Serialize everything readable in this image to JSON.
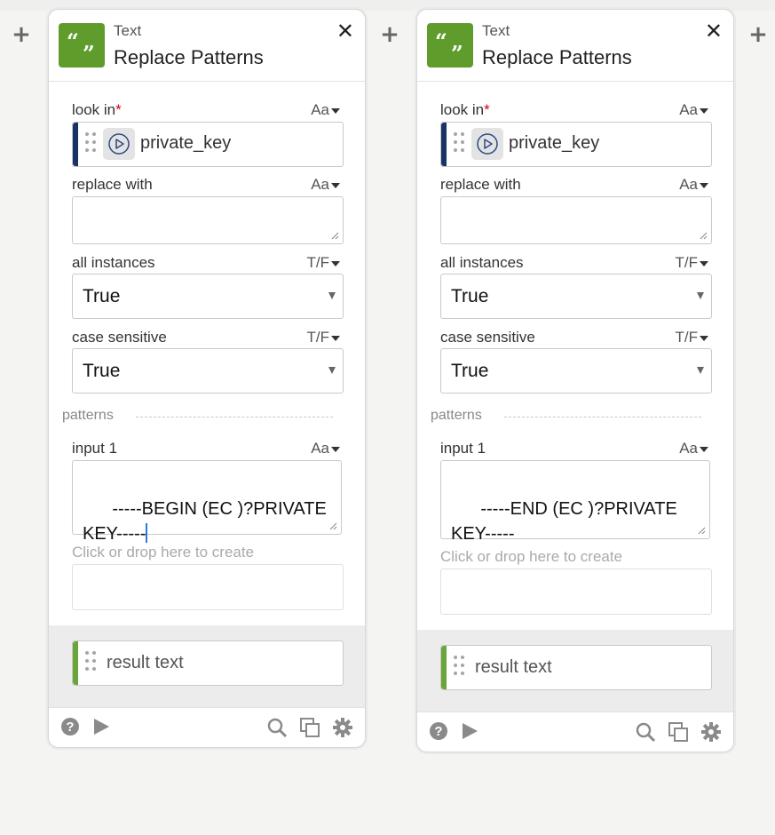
{
  "add_icon": "plus-icon",
  "cards": [
    {
      "category": "Text",
      "title": "Replace Patterns",
      "close_glyph": "✕",
      "look_in": {
        "label": "look in",
        "required_mark": "*",
        "type": "Aa",
        "variable": "private_key"
      },
      "replace_with": {
        "label": "replace with",
        "type": "Aa",
        "value": ""
      },
      "all_instances": {
        "label": "all instances",
        "type": "T/F",
        "value": "True"
      },
      "case_sensitive": {
        "label": "case sensitive",
        "type": "T/F",
        "value": "True"
      },
      "patterns_label": "patterns",
      "input1": {
        "label": "input 1",
        "type": "Aa",
        "value": "-----BEGIN (EC )?PRIVATE KEY-----"
      },
      "drop_hint": "Click or drop here to create",
      "output": "result text"
    },
    {
      "category": "Text",
      "title": "Replace Patterns",
      "close_glyph": "✕",
      "look_in": {
        "label": "look in",
        "required_mark": "*",
        "type": "Aa",
        "variable": "private_key"
      },
      "replace_with": {
        "label": "replace with",
        "type": "Aa",
        "value": ""
      },
      "all_instances": {
        "label": "all instances",
        "type": "T/F",
        "value": "True"
      },
      "case_sensitive": {
        "label": "case sensitive",
        "type": "T/F",
        "value": "True"
      },
      "patterns_label": "patterns",
      "input1": {
        "label": "input 1",
        "type": "Aa",
        "value": "-----END (EC )?PRIVATE KEY-----"
      },
      "drop_hint": "Click or drop here to create",
      "output": "result text"
    }
  ],
  "colors": {
    "tile": "#5f9c2c",
    "input_accent": "#1a3367",
    "output_accent": "#6aa53a",
    "required": "#d0021b"
  },
  "footer_icons": [
    "help-icon",
    "run-icon",
    "search-icon",
    "duplicate-icon",
    "settings-icon"
  ]
}
